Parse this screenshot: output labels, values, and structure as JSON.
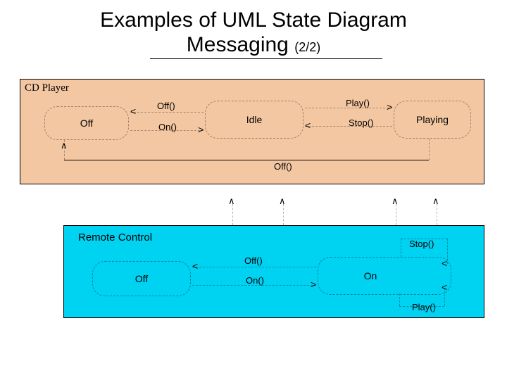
{
  "title_line1": "Examples of UML State Diagram",
  "title_line2": "Messaging",
  "title_page": "(2/2)",
  "cd": {
    "title": "CD Player",
    "states": {
      "off": "Off",
      "idle": "Idle",
      "playing": "Playing"
    },
    "events": {
      "off": "Off()",
      "on": "On()",
      "play": "Play()",
      "stop": "Stop()",
      "off2": "Off()"
    }
  },
  "rc": {
    "title": "Remote Control",
    "states": {
      "off": "Off",
      "on": "On"
    },
    "events": {
      "off": "Off()",
      "on": "On()",
      "stop": "Stop()",
      "play": "Play()"
    }
  }
}
